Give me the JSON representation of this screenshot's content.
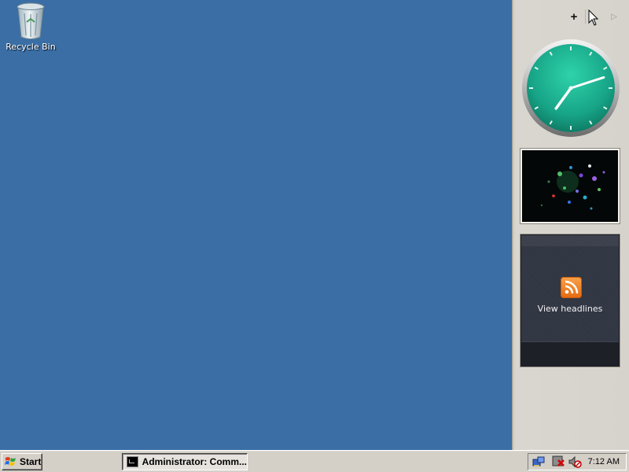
{
  "desktop": {
    "background": "#3a6ea5",
    "icons": [
      {
        "label": "Recycle Bin",
        "icon": "recycle-bin-icon"
      }
    ]
  },
  "sidebar": {
    "toolbar": {
      "add_label": "+",
      "add_icon": "add-gadget-icon",
      "next_icon": "next-page-icon"
    },
    "gadgets": {
      "clock": {
        "face_color": "#1aa98a",
        "hour": 7,
        "minute": 12
      },
      "slideshow": {
        "icon": "slideshow-image"
      },
      "feed": {
        "icon": "rss-feed-icon",
        "label": "View headlines"
      }
    }
  },
  "taskbar": {
    "start_label": "Start",
    "tasks": [
      {
        "label": "Administrator: Comm...",
        "icon": "command-prompt-icon"
      }
    ],
    "tray": {
      "icons": [
        "network-icon",
        "security-alert-icon",
        "volume-muted-icon"
      ],
      "time": "7:12 AM"
    }
  }
}
